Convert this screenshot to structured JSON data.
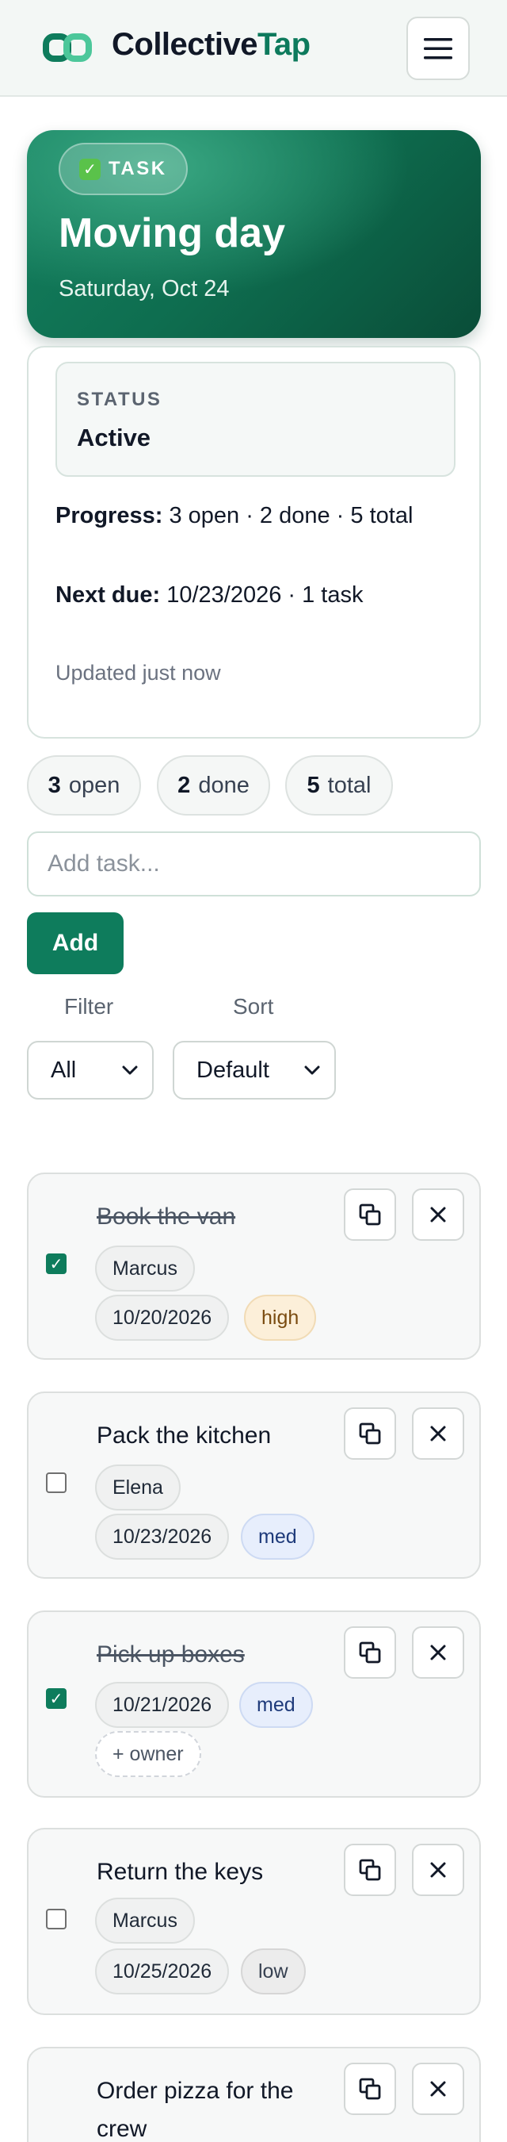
{
  "header": {
    "brand_part1": "Collective",
    "brand_part2": "Tap"
  },
  "hero": {
    "badge_icon": "check-mark-icon",
    "badge_label": "TASK",
    "title": "Moving day",
    "date": "Saturday, Oct 24"
  },
  "info": {
    "status_label": "STATUS",
    "status_value": "Active",
    "progress_label": "Progress:",
    "progress_value": "3 open · 2 done · 5 total",
    "next_due_label": "Next due:",
    "next_due_value": "10/23/2026 · 1 task",
    "updated": "Updated just now"
  },
  "counts": [
    {
      "num": "3",
      "label": "open"
    },
    {
      "num": "2",
      "label": "done"
    },
    {
      "num": "5",
      "label": "total"
    }
  ],
  "add": {
    "placeholder": "Add task...",
    "button_label": "Add"
  },
  "controls": {
    "filter_label": "Filter",
    "filter_value": "All",
    "sort_label": "Sort",
    "sort_value": "Default"
  },
  "tasks": [
    {
      "title": "Book the van",
      "done": true,
      "owner": "Marcus",
      "due": "10/20/2026",
      "priority": "high"
    },
    {
      "title": "Pack the kitchen",
      "done": false,
      "owner": "Elena",
      "due": "10/23/2026",
      "priority": "med"
    },
    {
      "title": "Pick up boxes",
      "done": true,
      "owner_placeholder": "+ owner",
      "due": "10/21/2026",
      "priority": "med"
    },
    {
      "title": "Return the keys",
      "done": false,
      "owner": "Marcus",
      "due": "10/25/2026",
      "priority": "low"
    },
    {
      "title": "Order pizza for the crew",
      "done": false
    }
  ],
  "colors": {
    "accent": "#0e7c5c",
    "hero_dark": "#0a4d38",
    "priority_high_bg": "#fcefd9",
    "priority_med_bg": "#e7eefc",
    "priority_low_bg": "#ececec"
  }
}
